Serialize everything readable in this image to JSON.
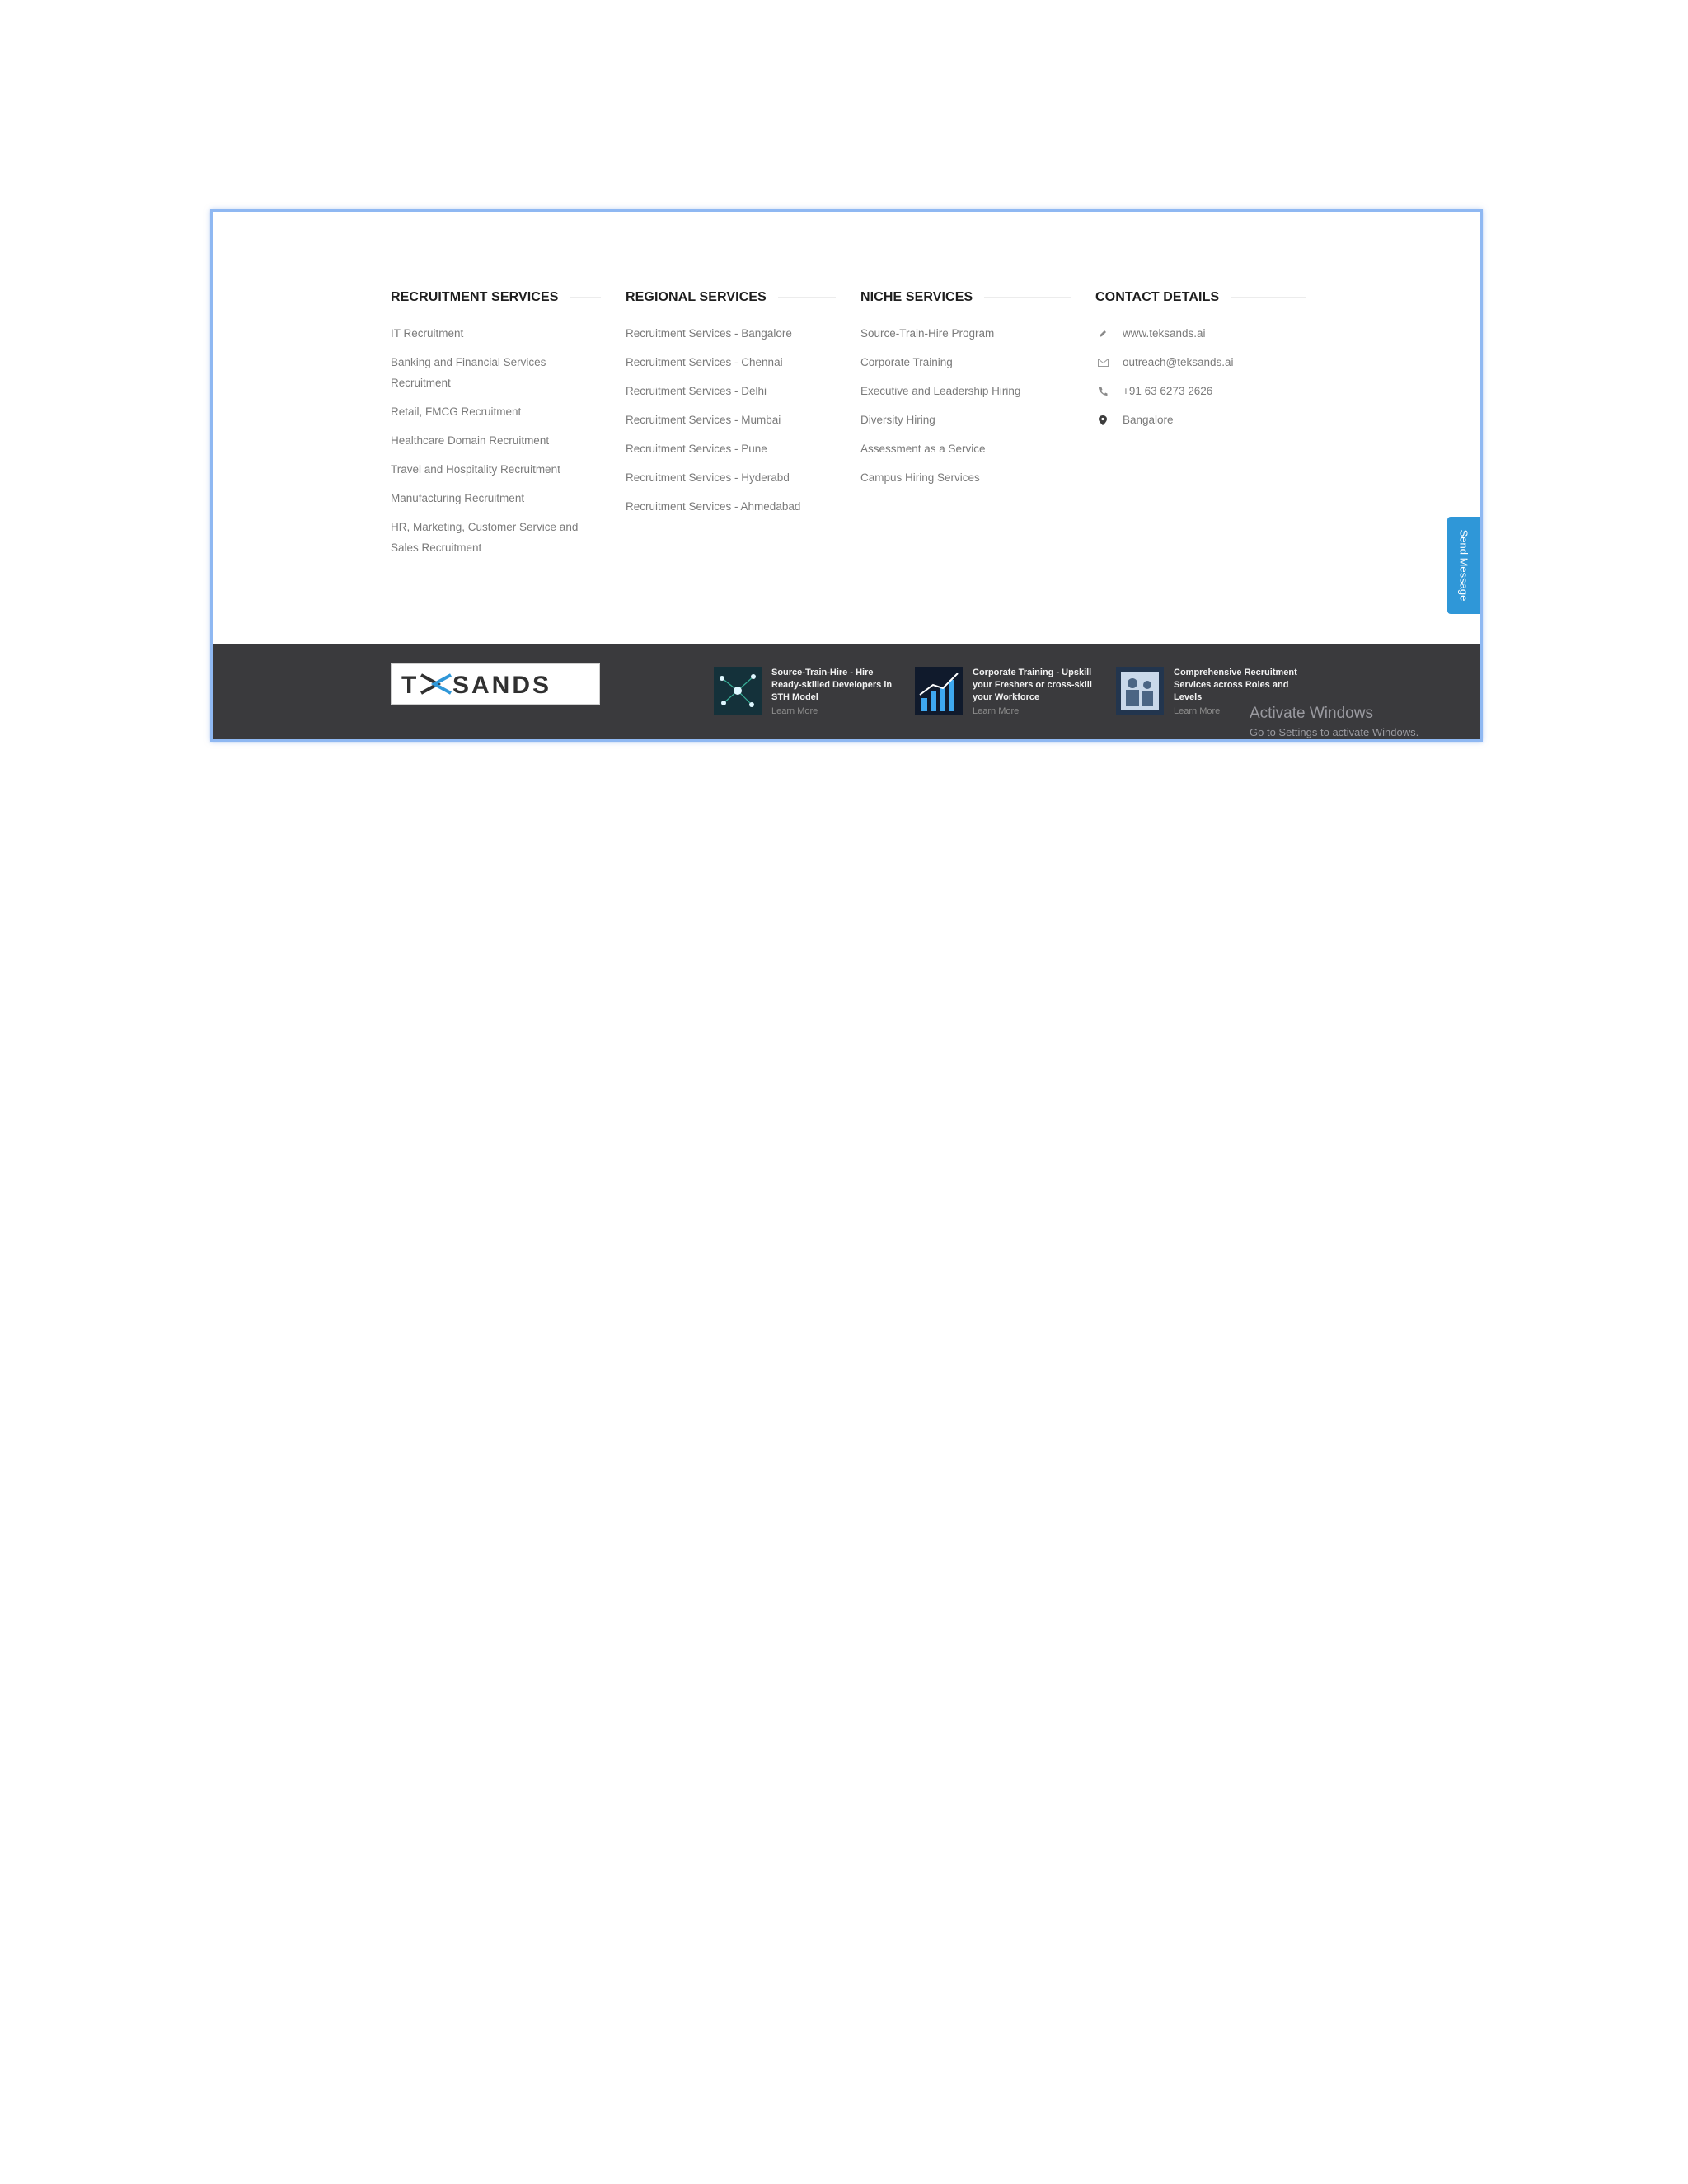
{
  "columns": {
    "recruitment": {
      "heading": "RECRUITMENT SERVICES",
      "items": [
        "IT Recruitment",
        "Banking and Financial Services Recruitment",
        "Retail, FMCG Recruitment",
        "Healthcare Domain Recruitment",
        "Travel and Hospitality Recruitment",
        "Manufacturing Recruitment",
        "HR, Marketing, Customer Service and Sales Recruitment"
      ]
    },
    "regional": {
      "heading": "REGIONAL SERVICES",
      "items": [
        "Recruitment Services - Bangalore",
        "Recruitment Services - Chennai",
        "Recruitment Services - Delhi",
        "Recruitment Services - Mumbai",
        "Recruitment Services - Pune",
        "Recruitment Services - Hyderabd",
        "Recruitment Services - Ahmedabad"
      ]
    },
    "niche": {
      "heading": "NICHE SERVICES",
      "items": [
        "Source-Train-Hire Program",
        "Corporate Training",
        "Executive and Leadership Hiring",
        "Diversity Hiring",
        "Assessment as a Service",
        "Campus Hiring Services"
      ]
    },
    "contact": {
      "heading": "CONTACT DETAILS",
      "items": [
        {
          "icon": "pencil-icon",
          "text": "www.teksands.ai"
        },
        {
          "icon": "mail-icon",
          "text": "outreach@teksands.ai"
        },
        {
          "icon": "phone-icon",
          "text": "+91 63 6273 2626"
        },
        {
          "icon": "location-icon",
          "text": "Bangalore"
        }
      ]
    }
  },
  "send_message": "Send Message",
  "logo": {
    "text": "TEKSANDS",
    "accent": "#2f97d8"
  },
  "posts": [
    {
      "title": "Source-Train-Hire - Hire Ready-skilled Developers in STH Model",
      "link": "Learn More"
    },
    {
      "title": "Corporate Training - Upskill your Freshers or cross-skill your Workforce",
      "link": "Learn More"
    },
    {
      "title": "Comprehensive Recruitment Services across Roles and Levels",
      "link": "Learn More"
    }
  ],
  "watermark": {
    "title": "Activate Windows",
    "subtitle": "Go to Settings to activate Windows."
  },
  "colors": {
    "footer_bar": "#3a3a3d",
    "send_message_bg": "#2f97d8",
    "frame_border": "#8fb8f2"
  }
}
